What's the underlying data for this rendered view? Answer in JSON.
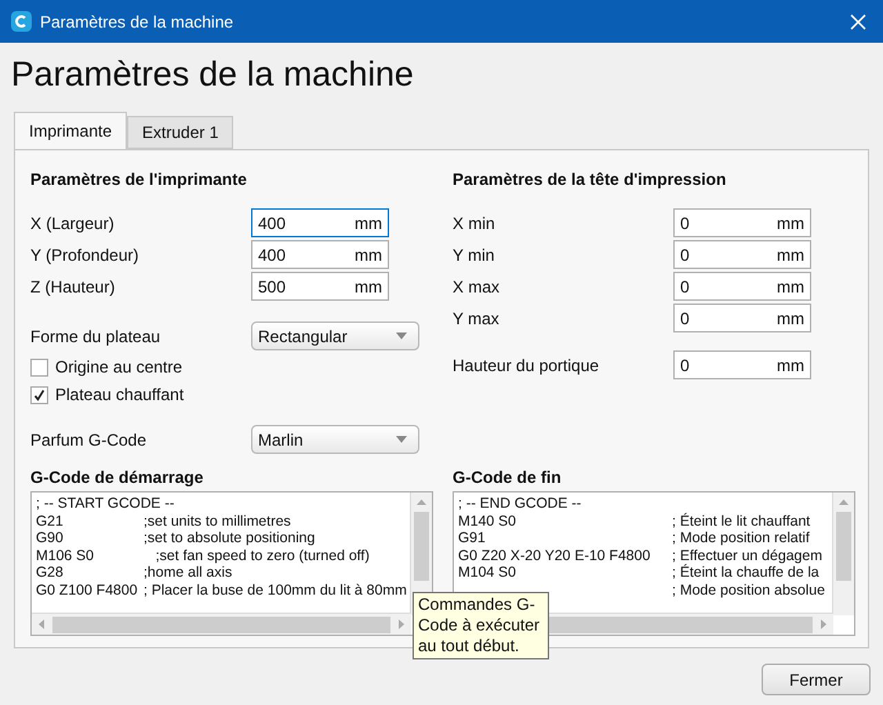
{
  "window": {
    "title": "Paramètres de la machine"
  },
  "heading": "Paramètres de la machine",
  "tabs": [
    {
      "label": "Imprimante",
      "selected": true
    },
    {
      "label": "Extruder 1",
      "selected": false
    }
  ],
  "printer_settings": {
    "title": "Paramètres de l'imprimante",
    "fields": [
      {
        "label": "X (Largeur)",
        "value": "400",
        "unit": "mm",
        "focused": true
      },
      {
        "label": "Y (Profondeur)",
        "value": "400",
        "unit": "mm",
        "focused": false
      },
      {
        "label": "Z (Hauteur)",
        "value": "500",
        "unit": "mm",
        "focused": false
      }
    ],
    "build_plate_shape": {
      "label": "Forme du plateau",
      "value": "Rectangular"
    },
    "checkboxes": [
      {
        "label": "Origine au centre",
        "checked": false
      },
      {
        "label": "Plateau chauffant",
        "checked": true
      }
    ],
    "gcode_flavor": {
      "label": "Parfum G-Code",
      "value": "Marlin"
    }
  },
  "printhead_settings": {
    "title": "Paramètres de la tête d'impression",
    "fields": [
      {
        "label": "X min",
        "value": "0",
        "unit": "mm"
      },
      {
        "label": "Y min",
        "value": "0",
        "unit": "mm"
      },
      {
        "label": "X max",
        "value": "0",
        "unit": "mm"
      },
      {
        "label": "Y max",
        "value": "0",
        "unit": "mm"
      }
    ],
    "gantry_height": {
      "label": "Hauteur du portique",
      "value": "0",
      "unit": "mm"
    }
  },
  "start_gcode": {
    "title": "G-Code de démarrage",
    "lines": [
      {
        "code": "; -- START GCODE --"
      },
      {
        "code": "G21",
        "comment": ";set units to millimetres"
      },
      {
        "code": "G90",
        "comment": ";set to absolute positioning"
      },
      {
        "code": "M106 S0",
        "comment": "   ;set fan speed to zero (turned off)"
      },
      {
        "code": "G28",
        "comment": ";home all axis"
      },
      {
        "code": "G0 Z100 F4800",
        "comment": "; Placer la buse de 100mm du lit à 80mm"
      }
    ]
  },
  "end_gcode": {
    "title": "G-Code de fin",
    "lines": [
      {
        "code": "; -- END GCODE --"
      },
      {
        "code": "M140 S0",
        "comment": "; Éteint le lit chauffant"
      },
      {
        "code": "G91",
        "comment": "; Mode position relatif"
      },
      {
        "code": "G0 Z20 X-20 Y20 E-10 F4800",
        "comment": "; Effectuer un dégagem"
      },
      {
        "code": "M104 S0",
        "comment": "; Éteint la chauffe de la"
      },
      {
        "comment": "; Mode position absolue"
      }
    ]
  },
  "tooltip": "Commandes G-Code à exécuter au tout début.",
  "buttons": [
    "Fermer"
  ]
}
